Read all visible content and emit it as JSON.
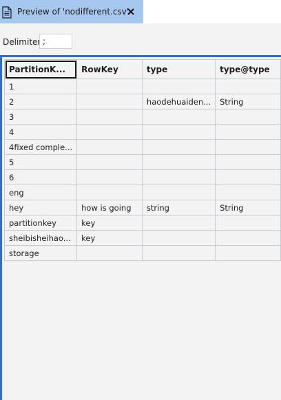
{
  "tab": {
    "title": "Preview of 'nodifferent.csv'",
    "icon": "document-icon",
    "close_icon": "close-icon"
  },
  "delimiter": {
    "label": "Delimiter:",
    "value": ";"
  },
  "table": {
    "columns": [
      "PartitionK...",
      "RowKey",
      "type",
      "type@type"
    ],
    "rows": [
      [
        "1",
        "",
        "",
        ""
      ],
      [
        "2",
        "",
        "haodehuaiden...",
        "String"
      ],
      [
        "3",
        "",
        "",
        ""
      ],
      [
        "4",
        "",
        "",
        ""
      ],
      [
        "4fixed comple...",
        "",
        "",
        ""
      ],
      [
        "5",
        "",
        "",
        ""
      ],
      [
        "6",
        "",
        "",
        ""
      ],
      [
        "eng",
        "",
        "",
        ""
      ],
      [
        "hey",
        "how is going",
        "string",
        "String"
      ],
      [
        "partitionkey",
        "key",
        "",
        ""
      ],
      [
        "sheibisheihao...",
        "key",
        "",
        ""
      ],
      [
        "storage",
        "",
        "",
        ""
      ]
    ]
  },
  "colors": {
    "tab_background": "#a6c8ee",
    "accent_border": "#3a6bc4",
    "grid_background": "#f3f3f3"
  }
}
